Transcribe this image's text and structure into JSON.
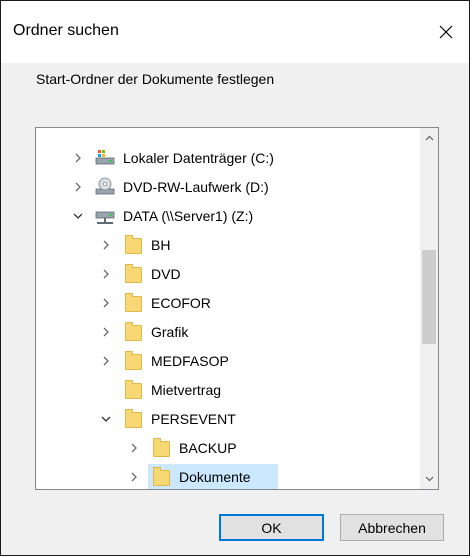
{
  "dialog": {
    "title": "Ordner suchen",
    "prompt": "Start-Ordner der Dokumente festlegen",
    "ok_label": "OK",
    "cancel_label": "Abbrechen"
  },
  "tree": {
    "items": [
      {
        "label": "Lokaler Datenträger (C:)",
        "icon": "local-disk-icon",
        "chevron": "collapsed"
      },
      {
        "label": "DVD-RW-Laufwerk (D:)",
        "icon": "dvd-drive-icon",
        "chevron": "collapsed"
      },
      {
        "label": "DATA (\\\\Server1) (Z:)",
        "icon": "network-drive-icon",
        "chevron": "expanded"
      },
      {
        "label": "BH",
        "icon": "folder-icon",
        "chevron": "collapsed"
      },
      {
        "label": "DVD",
        "icon": "folder-icon",
        "chevron": "collapsed"
      },
      {
        "label": "ECOFOR",
        "icon": "folder-icon",
        "chevron": "collapsed"
      },
      {
        "label": "Grafik",
        "icon": "folder-icon",
        "chevron": "collapsed"
      },
      {
        "label": "MEDFASOP",
        "icon": "folder-icon",
        "chevron": "collapsed"
      },
      {
        "label": "Mietvertrag",
        "icon": "folder-icon",
        "chevron": "none"
      },
      {
        "label": "PERSEVENT",
        "icon": "folder-icon",
        "chevron": "expanded"
      },
      {
        "label": "BACKUP",
        "icon": "folder-icon",
        "chevron": "collapsed"
      },
      {
        "label": "Dokumente",
        "icon": "folder-icon",
        "chevron": "collapsed",
        "selected": true
      }
    ]
  },
  "colors": {
    "selection": "#cce8ff",
    "folder": "#f8d775",
    "default_button_border": "#0078d7"
  }
}
